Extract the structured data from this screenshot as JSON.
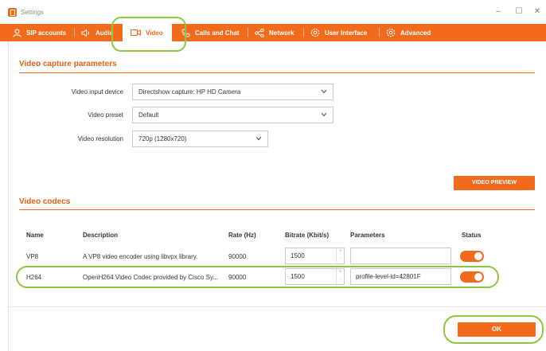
{
  "window": {
    "title": "Settings",
    "minimize": "–",
    "maximize": "☐",
    "close": "✕"
  },
  "tabs": [
    {
      "label": "SIP accounts",
      "icon": "user-icon"
    },
    {
      "label": "Audio",
      "icon": "speaker-icon"
    },
    {
      "label": "Video",
      "icon": "camera-icon",
      "active": true
    },
    {
      "label": "Calls and Chat",
      "icon": "phone-icon"
    },
    {
      "label": "Network",
      "icon": "share-icon"
    },
    {
      "label": "User Interface",
      "icon": "gear-icon"
    },
    {
      "label": "Advanced",
      "icon": "gear-icon"
    }
  ],
  "capture": {
    "title": "Video capture parameters",
    "input_device_label": "Video input device",
    "input_device_value": "Directshow capture: HP HD Camera",
    "preset_label": "Video preset",
    "preset_value": "Default",
    "resolution_label": "Video resolution",
    "resolution_value": "720p (1280x720)",
    "preview_button": "VIDEO PREVIEW"
  },
  "codecs": {
    "title": "Video codecs",
    "headers": {
      "name": "Name",
      "description": "Description",
      "rate": "Rate (Hz)",
      "bitrate": "Bitrate (Kbit/s)",
      "parameters": "Parameters",
      "status": "Status"
    },
    "rows": [
      {
        "name": "VP8",
        "description": "A VP8 video encoder using libvpx library.",
        "rate": "90000",
        "bitrate": "1500",
        "parameters": "",
        "enabled": true
      },
      {
        "name": "H264",
        "description": "OpenH264 Video Codec provided by Cisco Sy...",
        "rate": "90000",
        "bitrate": "1500",
        "parameters": "profile-level-id=42801F",
        "enabled": true
      }
    ]
  },
  "footer": {
    "ok_button": "OK"
  },
  "colors": {
    "accent": "#f26b1d",
    "highlight": "#8dc63f"
  }
}
